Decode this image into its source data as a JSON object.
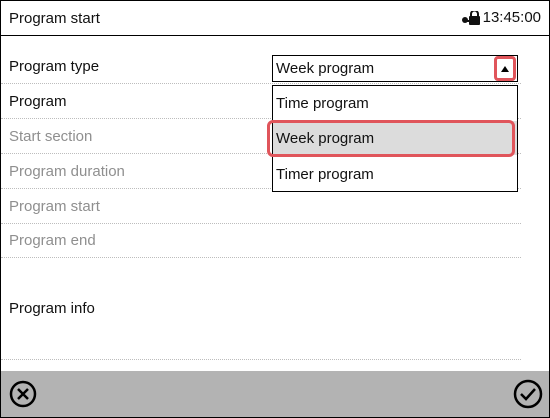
{
  "header": {
    "title": "Program start",
    "time": "13:45:00",
    "icon": "lock-icon"
  },
  "fields": [
    {
      "label": "Program type",
      "state": "active"
    },
    {
      "label": "Program",
      "state": "active"
    },
    {
      "label": "Start section",
      "state": "disabled"
    },
    {
      "label": "Program duration",
      "state": "disabled"
    },
    {
      "label": "Program start",
      "state": "disabled"
    },
    {
      "label": "Program end",
      "state": "disabled"
    },
    {
      "label": "Program info",
      "state": "active"
    }
  ],
  "program_type_select": {
    "value": "Week program",
    "options": [
      "Time program",
      "Week program",
      "Timer program"
    ],
    "selected_option": "Week program"
  },
  "footer": {
    "cancel_icon": "cancel-circle-icon",
    "confirm_icon": "check-circle-icon"
  },
  "colors": {
    "highlight": "#e0555b",
    "footer_bg": "#b3b3b3",
    "disabled_text": "#8f8f8f"
  }
}
